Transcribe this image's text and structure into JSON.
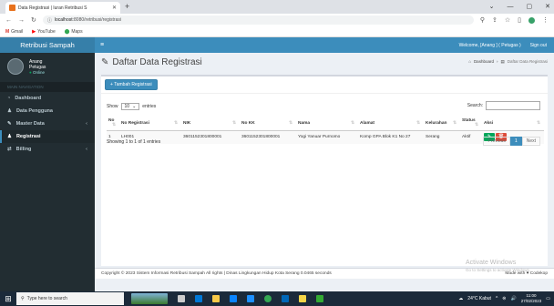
{
  "browser": {
    "tab_title": "Data Registrasi | Iuran Retribusi S",
    "url_host": "localhost",
    "url_path": ":8080/retribusi/registrasi",
    "bookmarks": [
      "Gmail",
      "YouTube",
      "Maps"
    ]
  },
  "app": {
    "logo": "Retribusi Sampah",
    "welcome": "Welcome, [Anang ] ( Petugas )",
    "signout": "Sign out"
  },
  "sidebar": {
    "user_name": "Anang",
    "user_role": "Petugas",
    "user_status": "Online",
    "nav_header": "MAIN NAVIGATION",
    "items": [
      {
        "label": "Dashboard",
        "icon": "dashboard-icon"
      },
      {
        "label": "Data Pengguna",
        "icon": "user-icon"
      },
      {
        "label": "Master Data",
        "icon": "edit-icon"
      },
      {
        "label": "Registrasi",
        "icon": "user-icon"
      },
      {
        "label": "Billing",
        "icon": "exchange-icon"
      }
    ]
  },
  "page": {
    "title": "Daftar Data Registrasi",
    "breadcrumb_home": "Dashboard",
    "breadcrumb_current": "Daftar Data Registrasi",
    "add_button": "+ Tambah Registrasi",
    "show_label": "Show",
    "show_value": "10",
    "entries_label": "entries",
    "search_label": "Search:",
    "search_value": "",
    "info": "Showing 1 to 1 of 1 entries",
    "prev": "Previous",
    "page": "1",
    "next": "Next"
  },
  "table": {
    "headers": [
      "No",
      "No Registrasi",
      "NIK",
      "No KK",
      "Nama",
      "Alamat",
      "Kelurahan",
      "Status",
      "Aksi"
    ],
    "rows": [
      [
        "1",
        "LH001",
        "3601152301800001",
        "3601152301800001",
        "Yogi Yanuar Purnomo",
        "Komp GPA Blok K1 No 27",
        "Serang",
        "Aktif"
      ]
    ]
  },
  "footer": {
    "copyright": "Copyright © 2023 Sistem Informasi Retribusi Sampah All rights | Dinas Lingkungan Hidup Kota Serang 0.0465 seconds",
    "made": "Made with ♥ Codekop"
  },
  "watermark": {
    "title": "Activate Windows",
    "sub": "Go to Settings to activate Windows."
  },
  "taskbar": {
    "search_placeholder": "Type here to search",
    "weather": "24°C Kabut",
    "time": "11:00",
    "date": "27/02/2023"
  }
}
